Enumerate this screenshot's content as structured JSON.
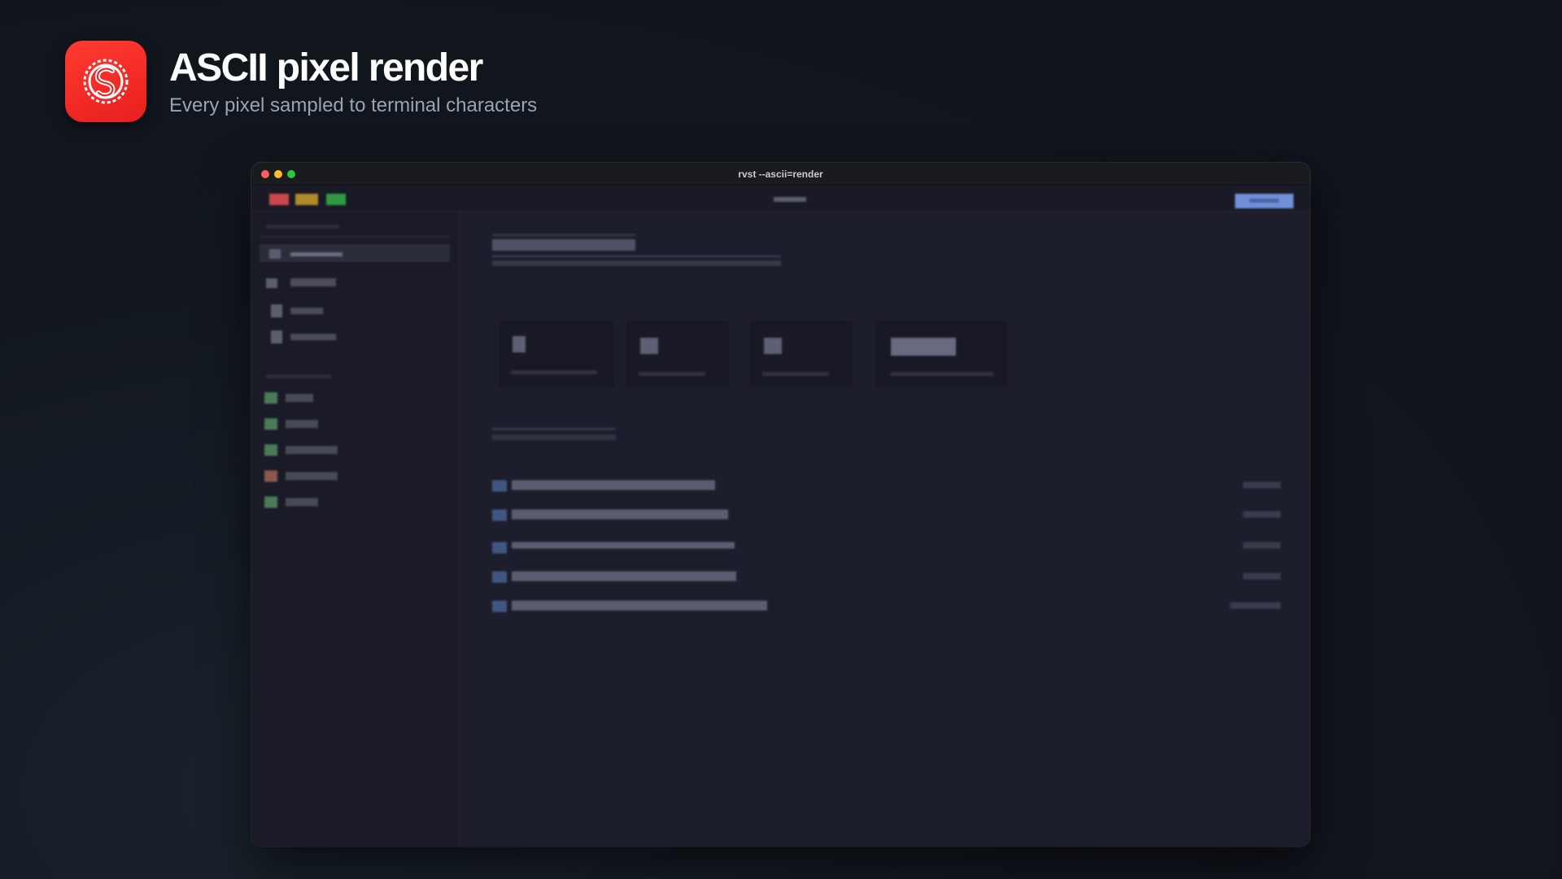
{
  "header": {
    "app_name": "ASCII pixel render",
    "tagline": "Every pixel sampled to terminal characters",
    "icon": "svelte-logo-icon",
    "icon_color": "#ff3b30"
  },
  "window": {
    "title": "rvst --ascii=render",
    "traffic_lights": [
      "close",
      "minimize",
      "maximize"
    ],
    "colors": {
      "close": "#fe5f57",
      "minimize": "#febc2e",
      "maximize": "#28c840",
      "accent": "#6f8fd6"
    }
  }
}
